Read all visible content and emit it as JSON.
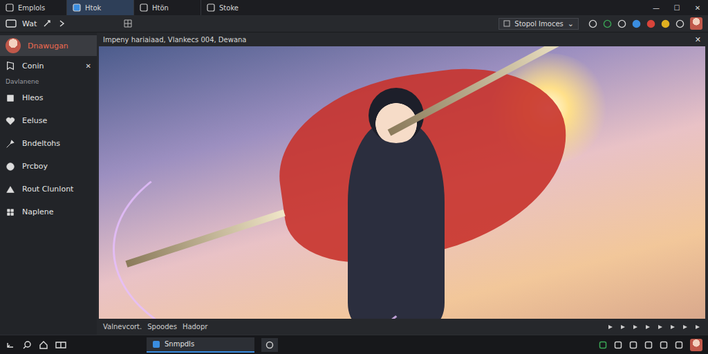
{
  "window": {
    "tabs": [
      {
        "label": "Emplols",
        "selected": false
      },
      {
        "label": "Htok",
        "selected": true
      },
      {
        "label": "Htön",
        "selected": false
      },
      {
        "label": "Stoke",
        "selected": false
      }
    ],
    "controls": [
      "—",
      "☐",
      "✕"
    ]
  },
  "toolbar": {
    "label": "Wat",
    "dropdown": "Stopol Imoces",
    "dropdown_arrow": "⌄"
  },
  "sidebar": {
    "profile": {
      "name": "Dnawugan",
      "selected": true
    },
    "pinned": {
      "label": "Conin",
      "close": "✕"
    },
    "section": "Davlanene",
    "items": [
      {
        "label": "Hleos",
        "selected": false
      },
      {
        "label": "Eeluse",
        "selected": false
      },
      {
        "label": "Bndeltohs",
        "selected": false
      },
      {
        "label": "Prcboy",
        "selected": false
      },
      {
        "label": "Rout Clunlont",
        "selected": false
      },
      {
        "label": "Naplene",
        "selected": false
      }
    ]
  },
  "content": {
    "title": "Impeny hariaiaad, Vlankecs 004, Dewana",
    "close": "✕",
    "footer": [
      "Valnevcort.",
      "Spoodes",
      "Hadopr"
    ]
  },
  "taskbar": {
    "apps": [
      {
        "label": "Snmpdls",
        "selected": true
      }
    ]
  }
}
